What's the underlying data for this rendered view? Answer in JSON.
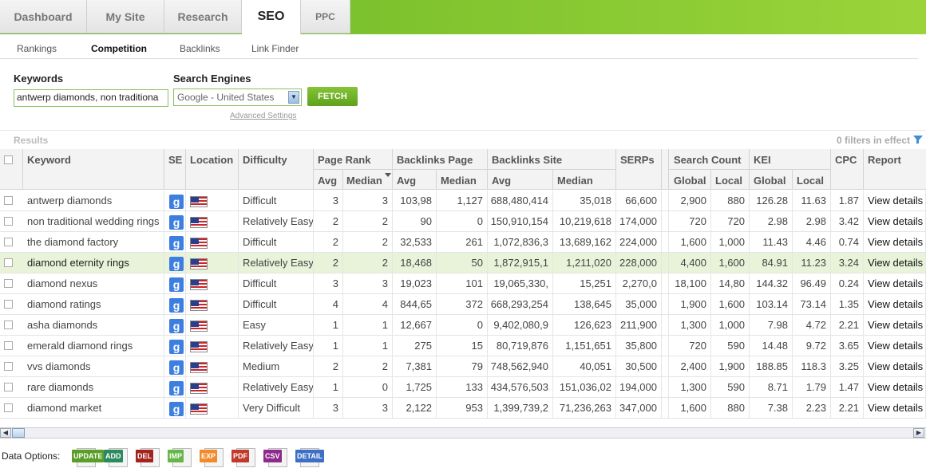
{
  "tabs": [
    {
      "label": "Dashboard"
    },
    {
      "label": "My Site"
    },
    {
      "label": "Research"
    },
    {
      "label": "SEO"
    },
    {
      "label": "PPC"
    }
  ],
  "subnav": [
    "Rankings",
    "Competition",
    "Backlinks",
    "Link Finder"
  ],
  "form": {
    "keywords_label": "Keywords",
    "keywords_value": "antwerp diamonds, non traditiona",
    "engines_label": "Search Engines",
    "engine_value": "Google - United States",
    "fetch_label": "FETCH",
    "advanced_link": "Advanced Settings"
  },
  "results": {
    "label": "Results",
    "filters": "0 filters in effect"
  },
  "headers": {
    "keyword": "Keyword",
    "se": "SE",
    "location": "Location",
    "difficulty": "Difficulty",
    "page_rank": "Page Rank",
    "backlinks_page": "Backlinks Page",
    "backlinks_site": "Backlinks Site",
    "serps": "SERPs",
    "search_count": "Search Count",
    "kei": "KEI",
    "cpc": "CPC",
    "report": "Report",
    "avg": "Avg",
    "median": "Median",
    "global": "Global",
    "local": "Local"
  },
  "rows": [
    {
      "keyword": "antwerp diamonds",
      "difficulty": "Difficult",
      "pr_avg": "3",
      "pr_med": "3",
      "bp_avg": "103,98",
      "bp_med": "1,127",
      "bs_avg": "688,480,414",
      "bs_med": "35,018",
      "serps": "66,600",
      "sc_global": "2,900",
      "sc_local": "880",
      "kei_global": "126.28",
      "kei_local": "11.63",
      "cpc": "1.87",
      "report": "View details"
    },
    {
      "keyword": "non traditional wedding rings",
      "difficulty": "Relatively Easy",
      "pr_avg": "2",
      "pr_med": "2",
      "bp_avg": "90",
      "bp_med": "0",
      "bs_avg": "150,910,154",
      "bs_med": "10,219,618",
      "serps": "174,000",
      "sc_global": "720",
      "sc_local": "720",
      "kei_global": "2.98",
      "kei_local": "2.98",
      "cpc": "3.42",
      "report": "View details"
    },
    {
      "keyword": "the diamond factory",
      "difficulty": "Difficult",
      "pr_avg": "2",
      "pr_med": "2",
      "bp_avg": "32,533",
      "bp_med": "261",
      "bs_avg": "1,072,836,3",
      "bs_med": "13,689,162",
      "serps": "224,000",
      "sc_global": "1,600",
      "sc_local": "1,000",
      "kei_global": "11.43",
      "kei_local": "4.46",
      "cpc": "0.74",
      "report": "View details"
    },
    {
      "keyword": "diamond eternity rings",
      "difficulty": "Relatively Easy",
      "pr_avg": "2",
      "pr_med": "2",
      "bp_avg": "18,468",
      "bp_med": "50",
      "bs_avg": "1,872,915,1",
      "bs_med": "1,211,020",
      "serps": "228,000",
      "sc_global": "4,400",
      "sc_local": "1,600",
      "kei_global": "84.91",
      "kei_local": "11.23",
      "cpc": "3.24",
      "report": "View details"
    },
    {
      "keyword": "diamond nexus",
      "difficulty": "Difficult",
      "pr_avg": "3",
      "pr_med": "3",
      "bp_avg": "19,023",
      "bp_med": "101",
      "bs_avg": "19,065,330,",
      "bs_med": "15,251",
      "serps": "2,270,0",
      "sc_global": "18,100",
      "sc_local": "14,80",
      "kei_global": "144.32",
      "kei_local": "96.49",
      "cpc": "0.24",
      "report": "View details"
    },
    {
      "keyword": "diamond ratings",
      "difficulty": "Difficult",
      "pr_avg": "4",
      "pr_med": "4",
      "bp_avg": "844,65",
      "bp_med": "372",
      "bs_avg": "668,293,254",
      "bs_med": "138,645",
      "serps": "35,000",
      "sc_global": "1,900",
      "sc_local": "1,600",
      "kei_global": "103.14",
      "kei_local": "73.14",
      "cpc": "1.35",
      "report": "View details"
    },
    {
      "keyword": "asha diamonds",
      "difficulty": "Easy",
      "pr_avg": "1",
      "pr_med": "1",
      "bp_avg": "12,667",
      "bp_med": "0",
      "bs_avg": "9,402,080,9",
      "bs_med": "126,623",
      "serps": "211,900",
      "sc_global": "1,300",
      "sc_local": "1,000",
      "kei_global": "7.98",
      "kei_local": "4.72",
      "cpc": "2.21",
      "report": "View details"
    },
    {
      "keyword": "emerald diamond rings",
      "difficulty": "Relatively Easy",
      "pr_avg": "1",
      "pr_med": "1",
      "bp_avg": "275",
      "bp_med": "15",
      "bs_avg": "80,719,876",
      "bs_med": "1,151,651",
      "serps": "35,800",
      "sc_global": "720",
      "sc_local": "590",
      "kei_global": "14.48",
      "kei_local": "9.72",
      "cpc": "3.65",
      "report": "View details"
    },
    {
      "keyword": "vvs diamonds",
      "difficulty": "Medium",
      "pr_avg": "2",
      "pr_med": "2",
      "bp_avg": "7,381",
      "bp_med": "79",
      "bs_avg": "748,562,940",
      "bs_med": "40,051",
      "serps": "30,500",
      "sc_global": "2,400",
      "sc_local": "1,900",
      "kei_global": "188.85",
      "kei_local": "118.3",
      "cpc": "3.25",
      "report": "View details"
    },
    {
      "keyword": "rare diamonds",
      "difficulty": "Relatively Easy",
      "pr_avg": "1",
      "pr_med": "0",
      "bp_avg": "1,725",
      "bp_med": "133",
      "bs_avg": "434,576,503",
      "bs_med": "151,036,02",
      "serps": "194,000",
      "sc_global": "1,300",
      "sc_local": "590",
      "kei_global": "8.71",
      "kei_local": "1.79",
      "cpc": "1.47",
      "report": "View details"
    },
    {
      "keyword": "diamond market",
      "difficulty": "Very Difficult",
      "pr_avg": "3",
      "pr_med": "3",
      "bp_avg": "2,122",
      "bp_med": "953",
      "bs_avg": "1,399,739,2",
      "bs_med": "71,236,263",
      "serps": "347,000",
      "sc_global": "1,600",
      "sc_local": "880",
      "kei_global": "7.38",
      "kei_local": "2.23",
      "cpc": "2.21",
      "report": "View details"
    }
  ],
  "selected_row": 3,
  "data_options": {
    "label": "Data Options:",
    "buttons": [
      {
        "label": "UPDATE",
        "color": "#5a9e2a"
      },
      {
        "label": "ADD",
        "color": "#2c8a5e"
      },
      {
        "label": "DEL",
        "color": "#a3231f"
      },
      {
        "label": "IMP",
        "color": "#66b64a"
      },
      {
        "label": "EXP",
        "color": "#f08a2a"
      },
      {
        "label": "PDF",
        "color": "#c0392b"
      },
      {
        "label": "CSV",
        "color": "#8e2a8c"
      },
      {
        "label": "DETAIL",
        "color": "#3f6fc4"
      }
    ]
  }
}
